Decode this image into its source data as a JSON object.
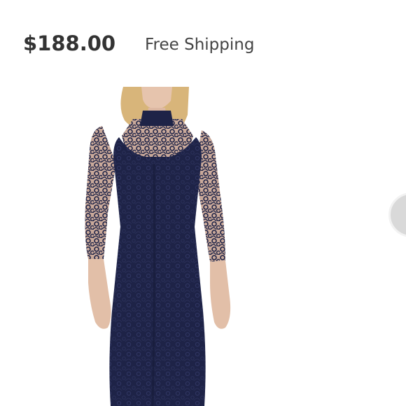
{
  "listing": {
    "price": "$188.00",
    "shipping": "Free Shipping"
  },
  "image": {
    "subject": "navy-lace-dress-photo",
    "dress_color": "#1e2347"
  },
  "carousel": {
    "next_icon": "chevron-right-icon"
  }
}
